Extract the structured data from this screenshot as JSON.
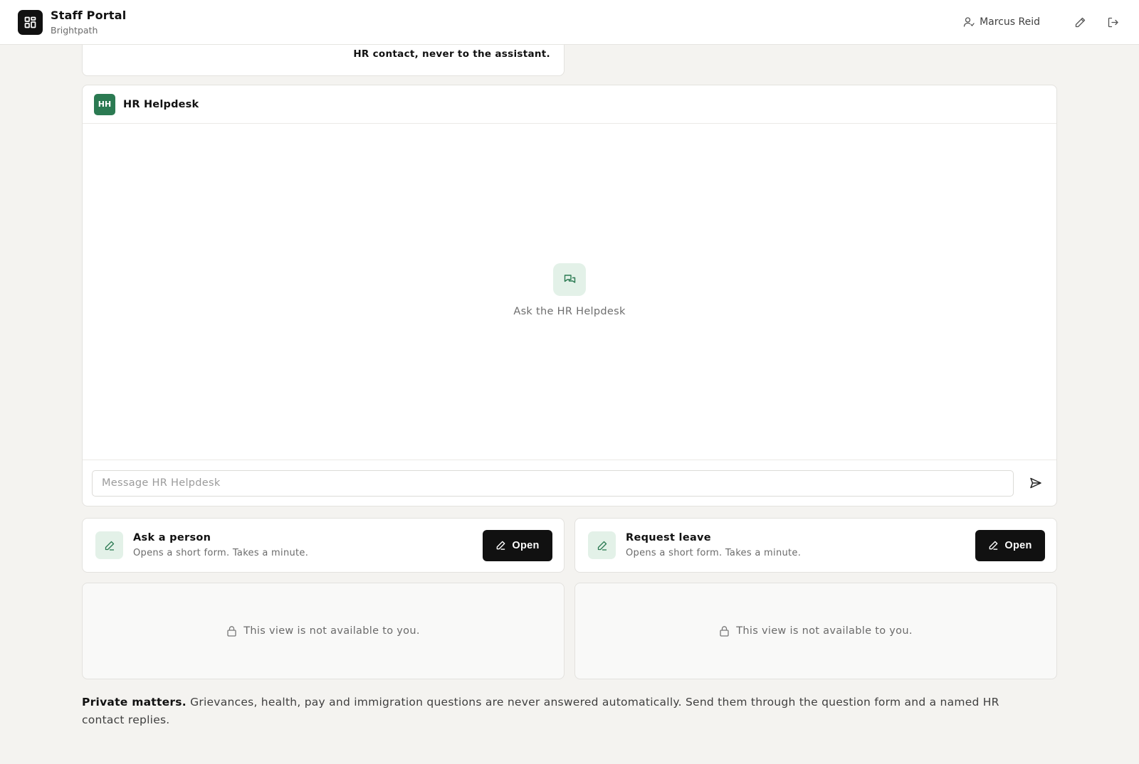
{
  "header": {
    "app_title": "Staff Portal",
    "org_name": "Brightpath",
    "user_name": "Marcus Reid",
    "icons": [
      "grid-icon",
      "user-icon",
      "pencil-icon",
      "logout-icon"
    ]
  },
  "previous_card": {
    "text": "HR contact, never to the assistant."
  },
  "chat": {
    "avatar_initials": "HH",
    "avatar_color": "#2b7a52",
    "title": "HR Helpdesk",
    "empty_state_text": "Ask the HR Helpdesk",
    "input_placeholder": "Message HR Helpdesk",
    "input_value": ""
  },
  "actions": [
    {
      "title": "Ask a person",
      "description": "Opens a short form. Takes a minute.",
      "button_label": "Open"
    },
    {
      "title": "Request leave",
      "description": "Opens a short form. Takes a minute.",
      "button_label": "Open"
    }
  ],
  "locked_views": [
    {
      "text": "This view is not available to you."
    },
    {
      "text": "This view is not available to you."
    }
  ],
  "note": {
    "bold": "Private matters.",
    "text": " Grievances, health, pay and immigration questions are never answered automatically. Send them through the question form and a named HR contact replies."
  },
  "colors": {
    "accent_green": "#2b7a52",
    "icon_tint_bg": "#e3f1e8",
    "page_bg": "#f4f3f0",
    "button_bg": "#111111"
  }
}
